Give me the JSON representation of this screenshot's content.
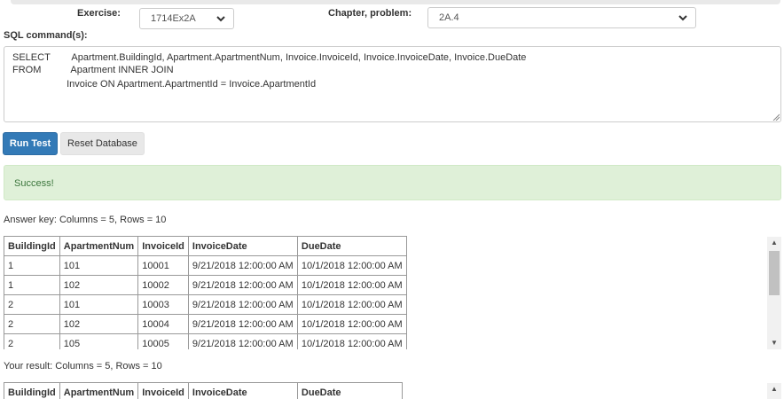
{
  "form": {
    "exercise_label": "Exercise:",
    "exercise_value": "1714Ex2A",
    "chapter_label": "Chapter, problem:",
    "chapter_value": "2A.4",
    "sql_label": "SQL command(s):",
    "sql_lines": [
      "SELECT        Apartment.BuildingId, Apartment.ApartmentNum, Invoice.InvoiceId, Invoice.InvoiceDate, Invoice.DueDate",
      "FROM           Apartment INNER JOIN",
      "                    Invoice ON Apartment.ApartmentId = Invoice.ApartmentId"
    ]
  },
  "buttons": {
    "run_test": "Run Test",
    "reset_database": "Reset Database"
  },
  "alert": {
    "message": "Success!"
  },
  "answer_key": {
    "caption": "Answer key: Columns = 5, Rows = 10",
    "columns": [
      "BuildingId",
      "ApartmentNum",
      "InvoiceId",
      "InvoiceDate",
      "DueDate"
    ],
    "rows": [
      [
        "1",
        "101",
        "10001",
        "9/21/2018 12:00:00 AM",
        "10/1/2018 12:00:00 AM"
      ],
      [
        "1",
        "102",
        "10002",
        "9/21/2018 12:00:00 AM",
        "10/1/2018 12:00:00 AM"
      ],
      [
        "2",
        "101",
        "10003",
        "9/21/2018 12:00:00 AM",
        "10/1/2018 12:00:00 AM"
      ],
      [
        "2",
        "102",
        "10004",
        "9/21/2018 12:00:00 AM",
        "10/1/2018 12:00:00 AM"
      ],
      [
        "2",
        "105",
        "10005",
        "9/21/2018 12:00:00 AM",
        "10/1/2018 12:00:00 AM"
      ]
    ]
  },
  "your_result": {
    "caption": "Your result: Columns = 5, Rows = 10",
    "columns": [
      "BuildingId",
      "ApartmentNum",
      "InvoiceId",
      "InvoiceDate",
      "DueDate"
    ]
  },
  "icons": {
    "select_chevron": "chevron-down-icon",
    "scroll_up": "arrow-up-icon",
    "scroll_down": "arrow-down-icon",
    "resize_handle": "resize-grip-icon"
  }
}
